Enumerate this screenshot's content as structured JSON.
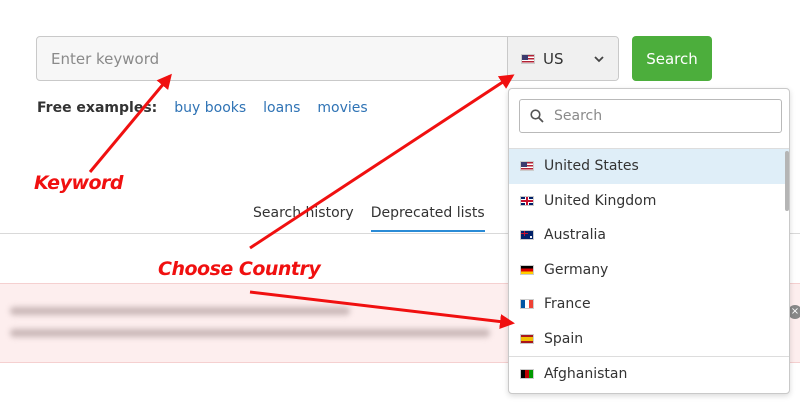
{
  "search": {
    "placeholder": "Enter keyword",
    "country_code": "US",
    "country_flag": "us-flag-icon",
    "button_label": "Search"
  },
  "examples": {
    "label": "Free examples:",
    "links": [
      "buy books",
      "loans",
      "movies"
    ]
  },
  "tabs": [
    {
      "label": "Search history",
      "active": false
    },
    {
      "label": "Deprecated lists",
      "active": true
    }
  ],
  "dropdown": {
    "search_placeholder": "Search",
    "items": [
      {
        "label": "United States",
        "flag": "us-flag-icon",
        "selected": true
      },
      {
        "label": "United Kingdom",
        "flag": "uk-flag-icon",
        "selected": false
      },
      {
        "label": "Australia",
        "flag": "au-flag-icon",
        "selected": false
      },
      {
        "label": "Germany",
        "flag": "de-flag-icon",
        "selected": false
      },
      {
        "label": "France",
        "flag": "fr-flag-icon",
        "selected": false
      },
      {
        "label": "Spain",
        "flag": "es-flag-icon",
        "selected": false
      },
      {
        "label": "Afghanistan",
        "flag": "af-flag-icon",
        "selected": false
      }
    ]
  },
  "annotations": {
    "keyword": "Keyword",
    "country": "Choose Country",
    "color": "#f01010"
  },
  "colors": {
    "accent_green": "#4cae3c",
    "link_blue": "#2f73b5",
    "tab_underline": "#2a8bd6",
    "selected_row": "#dfeef8"
  }
}
